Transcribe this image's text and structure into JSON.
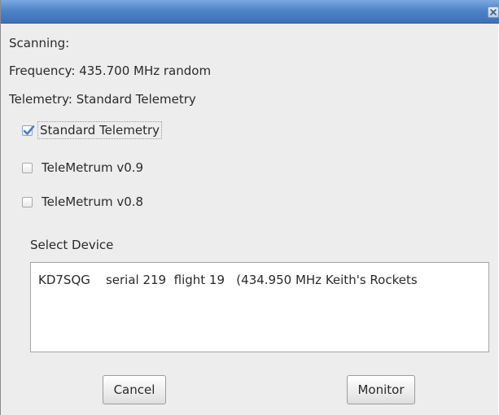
{
  "dialog": {
    "scanning_label": "Scanning:",
    "frequency_label": "Frequency: 435.700 MHz random",
    "telemetry_label": "Telemetry: Standard Telemetry"
  },
  "telemetry_options": [
    {
      "label": "Standard Telemetry",
      "checked": true
    },
    {
      "label": "TeleMetrum v0.9",
      "checked": false
    },
    {
      "label": "TeleMetrum v0.8",
      "checked": false
    }
  ],
  "device_list": {
    "title": "Select Device",
    "items": [
      "KD7SQG    serial 219  flight 19   (434.950 MHz Keith's Rockets"
    ]
  },
  "buttons": {
    "cancel_label": "Cancel",
    "monitor_label": "Monitor"
  },
  "colors": {
    "titlebar": "#4f84c9",
    "background": "#ededed",
    "checkmark": "#4a7fc6"
  },
  "icons": {
    "close": "close-icon",
    "check": "checkmark-icon"
  }
}
